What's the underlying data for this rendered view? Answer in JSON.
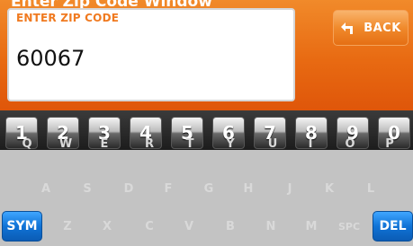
{
  "window_title": "Enter Zip Code Window",
  "zip_field": {
    "label": "ENTER ZIP CODE",
    "value": "60067"
  },
  "back_button": {
    "label": "BACK",
    "icon": "back-arrow-icon"
  },
  "number_keys": [
    "1",
    "2",
    "3",
    "4",
    "5",
    "6",
    "7",
    "8",
    "9",
    "0"
  ],
  "letter_rows": [
    [
      "Q",
      "W",
      "E",
      "R",
      "T",
      "Y",
      "U",
      "I",
      "O",
      "P"
    ],
    [
      "A",
      "S",
      "D",
      "F",
      "G",
      "H",
      "J",
      "K",
      "L"
    ],
    [
      "Z",
      "X",
      "C",
      "V",
      "B",
      "N",
      "M",
      "SPC"
    ]
  ],
  "sym_key": "SYM",
  "del_key": "DEL",
  "colors": {
    "accent_orange": "#e86a12",
    "label_orange": "#f07a20",
    "keyboard_bg": "#c3c3c3",
    "function_key_blue": "#1073d6"
  }
}
